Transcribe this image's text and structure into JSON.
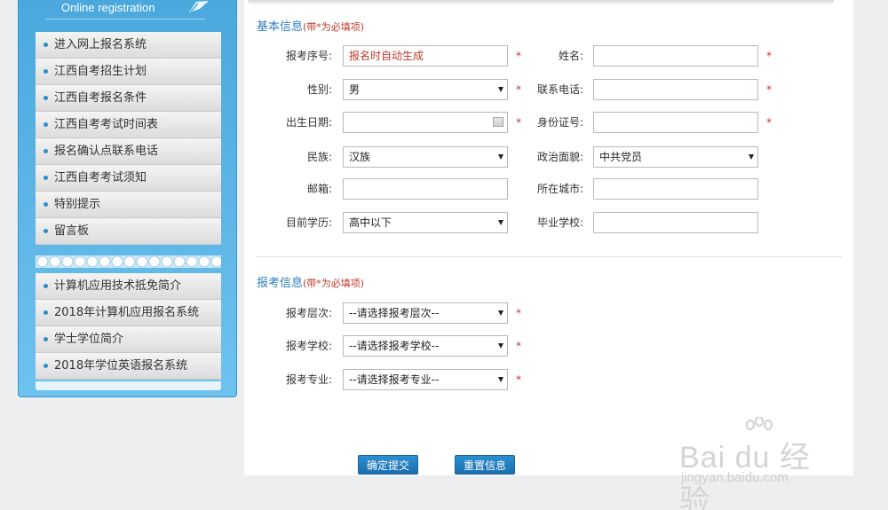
{
  "sidebar": {
    "title": "Online registration",
    "menu_group_1": [
      {
        "label": "进入网上报名系统"
      },
      {
        "label": "江西自考招生计划"
      },
      {
        "label": "江西自考报名条件"
      },
      {
        "label": "江西自考考试时间表"
      },
      {
        "label": "报名确认点联系电话"
      },
      {
        "label": "江西自考考试须知"
      },
      {
        "label": "特别提示"
      },
      {
        "label": "留言板"
      }
    ],
    "menu_group_2": [
      {
        "label": "计算机应用技术抵免简介"
      },
      {
        "label": "2018年计算机应用报名系统"
      },
      {
        "label": "学士学位简介"
      },
      {
        "label": "2018年学位英语报名系统"
      }
    ]
  },
  "basic_info": {
    "title": "基本信息",
    "required_note": "(带*为必填项)",
    "fields": {
      "exam_no_label": "报考序号:",
      "exam_no_value": "报名时自动生成",
      "name_label": "姓名:",
      "name_value": "",
      "gender_label": "性别:",
      "gender_value": "男",
      "phone_label": "联系电话:",
      "phone_value": "",
      "birth_label": "出生日期:",
      "birth_value": "",
      "id_label": "身份证号:",
      "id_value": "",
      "ethnicity_label": "民族:",
      "ethnicity_value": "汉族",
      "politics_label": "政治面貌:",
      "politics_value": "中共党员",
      "email_label": "邮箱:",
      "email_value": "",
      "city_label": "所在城市:",
      "city_value": "",
      "education_label": "目前学历:",
      "education_value": "高中以下",
      "school_label": "毕业学校:",
      "school_value": ""
    }
  },
  "exam_info": {
    "title": "报考信息",
    "required_note": "(带*为必填项)",
    "fields": {
      "level_label": "报考层次:",
      "level_value": "--请选择报考层次--",
      "school_label": "报考学校:",
      "school_value": "--请选择报考学校--",
      "major_label": "报考专业:",
      "major_value": "--请选择报考专业--"
    }
  },
  "buttons": {
    "submit": "确定提交",
    "reset": "重置信息"
  },
  "required_mark": "*",
  "watermark": {
    "brand": "Bai du 经验",
    "url": "jingyan.baidu.com"
  },
  "colors": {
    "sidebar_blue": "#4aa8dd",
    "section_title": "#2c7dbf",
    "required_red": "#c0392b",
    "button_blue": "#1b6fae"
  }
}
